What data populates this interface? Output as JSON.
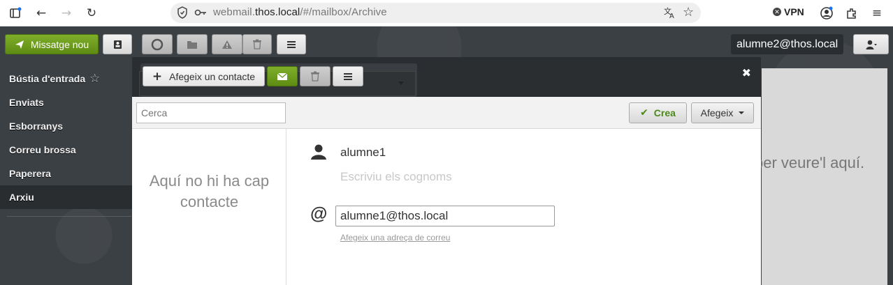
{
  "browser": {
    "url_prefix": "webmail.",
    "url_domain": "thos.local",
    "url_path": "/#/mailbox/Archive",
    "vpn_label": "VPN"
  },
  "app": {
    "compose_label": "Missatge nou",
    "user_label": "alumne2@thos.local",
    "folders": [
      {
        "label": "Bústia d'entrada"
      },
      {
        "label": "Enviats"
      },
      {
        "label": "Esborranys"
      },
      {
        "label": "Correu brossa"
      },
      {
        "label": "Paperera"
      },
      {
        "label": "Arxiu"
      }
    ],
    "message_pane_text": "ber veure'l aquí."
  },
  "modal": {
    "add_contact_label": "Afegeix un contacte",
    "search_placeholder": "Cerca",
    "create_label": "Crea",
    "add_label": "Afegeix",
    "empty_text": "Aquí no hi ha cap contacte",
    "contact_name": "alumne1",
    "surname_placeholder": "Escriviu els cognoms",
    "email_value": "alumne1@thos.local",
    "add_email_link": "Afegeix una adreça de correu",
    "at_symbol": "@"
  },
  "colors": {
    "accent_green": "#6b9b1f",
    "app_bg": "#3b4045",
    "modal_header": "#2b2e31"
  }
}
